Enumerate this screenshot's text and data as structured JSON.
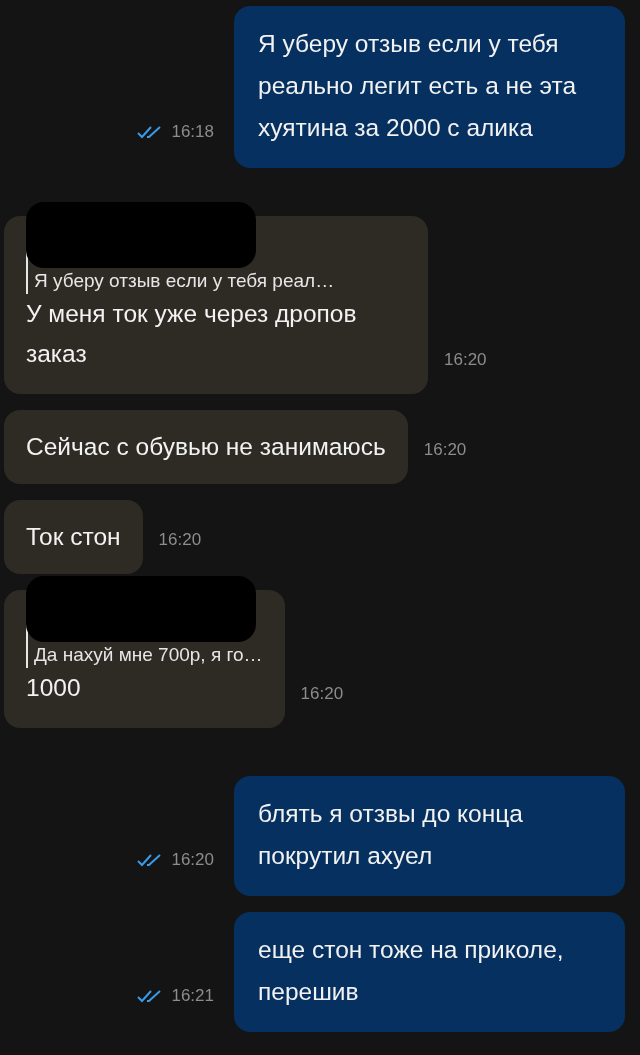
{
  "messages": [
    {
      "kind": "out",
      "text": "Я уберу отзыв если у тебя реально легит есть а не эта хуятина за 2000 с алика",
      "time": "16:18",
      "read": true
    },
    {
      "kind": "in",
      "quote": {
        "text": "Я уберу отзыв если у тебя реал…",
        "redacted": true
      },
      "text": "У меня ток уже через дропов заказ",
      "time": "16:20"
    },
    {
      "kind": "in",
      "text": "Сейчас с обувью не занимаюсь",
      "time": "16:20"
    },
    {
      "kind": "in",
      "text": "Ток стон",
      "time": "16:20"
    },
    {
      "kind": "in",
      "quote": {
        "text": "Да нахуй мне 700р, я го…",
        "redacted": true
      },
      "text": "1000",
      "time": "16:20"
    },
    {
      "kind": "out",
      "text": "блять я отзвы до конца покрутил ахуел",
      "time": "16:20",
      "read": true
    },
    {
      "kind": "out",
      "text": "еще стон тоже на приколе, перешив",
      "time": "16:21",
      "read": true
    }
  ]
}
